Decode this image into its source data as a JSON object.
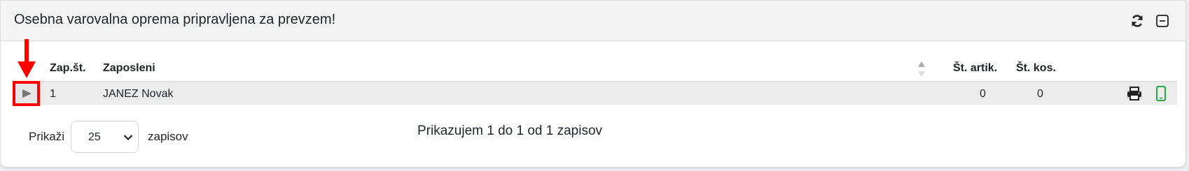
{
  "panel": {
    "title": "Osebna varovalna oprema pripravljena za prevzem!",
    "refresh_icon": "refresh-icon",
    "collapse_icon": "minus-square-icon"
  },
  "table": {
    "columns": [
      "Zap.št.",
      "Zaposleni",
      "Št. artik.",
      "Št. kos."
    ],
    "sort_icon": "sort-icon",
    "rows": [
      {
        "expand_icon": "caret-right-icon",
        "zap_st": "1",
        "zaposleni": "JANEZ Novak",
        "st_artik": "0",
        "st_kos": "0",
        "actions": [
          "print-icon",
          "mobile-icon"
        ]
      }
    ]
  },
  "length_menu": {
    "prefix": "Prikaži",
    "selected": "25",
    "suffix": "zapisov"
  },
  "info": "Prikazujem 1 do 1 od 1 zapisov",
  "colors": {
    "annotation_red": "#ff0000",
    "mobile_green": "#28a745",
    "row_bg": "#ececec",
    "header_bg": "#f4f4f4"
  }
}
